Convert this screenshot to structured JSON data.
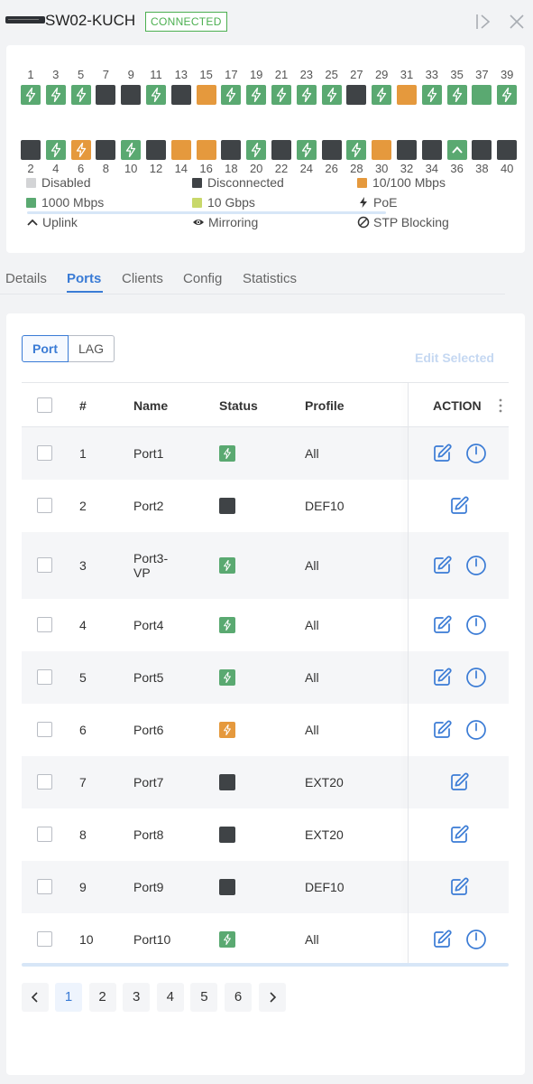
{
  "header": {
    "device_name": "SW02-KUCH",
    "status_badge": "CONNECTED",
    "collapse_icon": "collapse-panel-icon",
    "close_icon": "close-icon"
  },
  "colors": {
    "disabled": "#d3d4d6",
    "disconnected": "#3f4346",
    "speed_10_100": "#e5993d",
    "speed_1000": "#5aa971",
    "speed_10g": "#c8d86a",
    "accent": "#3a7bd5",
    "connected": "#4caf50"
  },
  "port_panel": {
    "top_ports": [
      {
        "num": "1",
        "state": "1000",
        "poe": true
      },
      {
        "num": "3",
        "state": "1000",
        "poe": true
      },
      {
        "num": "5",
        "state": "1000",
        "poe": true
      },
      {
        "num": "7",
        "state": "disconnected",
        "poe": false
      },
      {
        "num": "9",
        "state": "disconnected",
        "poe": false
      },
      {
        "num": "11",
        "state": "1000",
        "poe": true
      },
      {
        "num": "13",
        "state": "disconnected",
        "poe": false
      },
      {
        "num": "15",
        "state": "10_100",
        "poe": false
      },
      {
        "num": "17",
        "state": "1000",
        "poe": true
      },
      {
        "num": "19",
        "state": "1000",
        "poe": true
      },
      {
        "num": "21",
        "state": "1000",
        "poe": true
      },
      {
        "num": "23",
        "state": "1000",
        "poe": true
      },
      {
        "num": "25",
        "state": "1000",
        "poe": true
      },
      {
        "num": "27",
        "state": "disconnected",
        "poe": false
      },
      {
        "num": "29",
        "state": "1000",
        "poe": true
      },
      {
        "num": "31",
        "state": "10_100",
        "poe": false
      },
      {
        "num": "33",
        "state": "1000",
        "poe": true
      },
      {
        "num": "35",
        "state": "1000",
        "poe": true
      },
      {
        "num": "37",
        "state": "1000",
        "poe": false
      },
      {
        "num": "39",
        "state": "1000",
        "poe": true
      }
    ],
    "bottom_ports": [
      {
        "num": "2",
        "state": "disconnected",
        "poe": false
      },
      {
        "num": "4",
        "state": "1000",
        "poe": true
      },
      {
        "num": "6",
        "state": "10_100",
        "poe": true
      },
      {
        "num": "8",
        "state": "disconnected",
        "poe": false
      },
      {
        "num": "10",
        "state": "1000",
        "poe": true
      },
      {
        "num": "12",
        "state": "disconnected",
        "poe": false
      },
      {
        "num": "14",
        "state": "10_100",
        "poe": false
      },
      {
        "num": "16",
        "state": "10_100",
        "poe": false
      },
      {
        "num": "18",
        "state": "disconnected",
        "poe": false
      },
      {
        "num": "20",
        "state": "1000",
        "poe": true
      },
      {
        "num": "22",
        "state": "disconnected",
        "poe": false
      },
      {
        "num": "24",
        "state": "1000",
        "poe": true
      },
      {
        "num": "26",
        "state": "disconnected",
        "poe": false
      },
      {
        "num": "28",
        "state": "1000",
        "poe": true
      },
      {
        "num": "30",
        "state": "10_100",
        "poe": false
      },
      {
        "num": "32",
        "state": "disconnected",
        "poe": false
      },
      {
        "num": "34",
        "state": "disconnected",
        "poe": false
      },
      {
        "num": "36",
        "state": "1000",
        "uplink": true
      },
      {
        "num": "38",
        "state": "disconnected",
        "poe": false
      },
      {
        "num": "40",
        "state": "disconnected",
        "poe": false
      }
    ]
  },
  "legend": {
    "disabled": "Disabled",
    "disconnected": "Disconnected",
    "speed_10_100": "10/100 Mbps",
    "speed_1000": "1000 Mbps",
    "speed_10g": "10 Gbps",
    "poe": "PoE",
    "uplink": "Uplink",
    "mirroring": "Mirroring",
    "stp_blocking": "STP Blocking"
  },
  "tabs": [
    "Details",
    "Ports",
    "Clients",
    "Config",
    "Statistics"
  ],
  "active_tab": "Ports",
  "segment": {
    "port": "Port",
    "lag": "LAG"
  },
  "edit_selected": "Edit Selected",
  "table": {
    "headers": {
      "num": "#",
      "name": "Name",
      "status": "Status",
      "profile": "Profile",
      "action": "ACTION"
    },
    "rows": [
      {
        "num": "1",
        "name": "Port1",
        "status": "1000",
        "poe": true,
        "profile": "All",
        "power": true
      },
      {
        "num": "2",
        "name": "Port2",
        "status": "disconnected",
        "poe": false,
        "profile": "DEF10",
        "power": false
      },
      {
        "num": "3",
        "name": "Port3-VP",
        "status": "1000",
        "poe": true,
        "profile": "All",
        "power": true
      },
      {
        "num": "4",
        "name": "Port4",
        "status": "1000",
        "poe": true,
        "profile": "All",
        "power": true
      },
      {
        "num": "5",
        "name": "Port5",
        "status": "1000",
        "poe": true,
        "profile": "All",
        "power": true
      },
      {
        "num": "6",
        "name": "Port6",
        "status": "10_100",
        "poe": true,
        "profile": "All",
        "power": true
      },
      {
        "num": "7",
        "name": "Port7",
        "status": "disconnected",
        "poe": false,
        "profile": "EXT20",
        "power": false
      },
      {
        "num": "8",
        "name": "Port8",
        "status": "disconnected",
        "poe": false,
        "profile": "EXT20",
        "power": false
      },
      {
        "num": "9",
        "name": "Port9",
        "status": "disconnected",
        "poe": false,
        "profile": "DEF10",
        "power": false
      },
      {
        "num": "10",
        "name": "Port10",
        "status": "1000",
        "poe": true,
        "profile": "All",
        "power": true
      }
    ]
  },
  "pagination": {
    "pages": [
      "1",
      "2",
      "3",
      "4",
      "5",
      "6"
    ],
    "current": "1"
  }
}
